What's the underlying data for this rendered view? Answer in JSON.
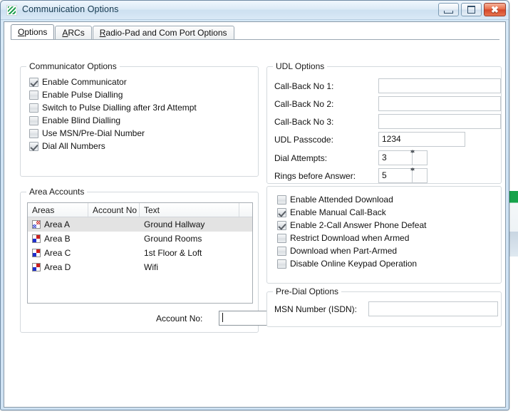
{
  "window": {
    "title": "Communication Options",
    "app_icon": "striped-green-icon",
    "buttons": {
      "minimize": "minimize-icon",
      "maximize": "maximize-icon",
      "close": "✖"
    }
  },
  "tabs": [
    {
      "label": "Options",
      "mnemonic": "O",
      "active": true
    },
    {
      "label": "ARCs",
      "mnemonic": "A",
      "active": false
    },
    {
      "label": "Radio-Pad and Com Port Options",
      "mnemonic": "R",
      "active": false
    }
  ],
  "communicator_options": {
    "legend": "Communicator Options",
    "items": [
      {
        "label": "Enable Communicator",
        "checked": true
      },
      {
        "label": "Enable Pulse Dialling",
        "checked": false
      },
      {
        "label": "Switch to Pulse Dialling after 3rd Attempt",
        "checked": false
      },
      {
        "label": "Enable Blind Dialling",
        "checked": false
      },
      {
        "label": "Use MSN/Pre-Dial Number",
        "checked": false
      },
      {
        "label": "Dial All Numbers",
        "checked": true
      }
    ]
  },
  "area_accounts": {
    "legend": "Area Accounts",
    "columns": [
      "Areas",
      "Account No",
      "Text",
      ""
    ],
    "rows": [
      {
        "area": "Area A",
        "account_no": "",
        "text": "Ground Hallway",
        "selected": true
      },
      {
        "area": "Area B",
        "account_no": "",
        "text": "Ground Rooms",
        "selected": false
      },
      {
        "area": "Area C",
        "account_no": "",
        "text": "1st Floor & Loft",
        "selected": false
      },
      {
        "area": "Area D",
        "account_no": "",
        "text": "Wifi",
        "selected": false
      }
    ],
    "account_no_label": "Account No:",
    "account_no_value": ""
  },
  "udl_options": {
    "legend": "UDL Options",
    "fields": [
      {
        "label": "Call-Back No 1:",
        "value": ""
      },
      {
        "label": "Call-Back No 2:",
        "value": ""
      },
      {
        "label": "Call-Back No 3:",
        "value": ""
      },
      {
        "label": "UDL Passcode:",
        "value": "1234"
      }
    ],
    "spinners": [
      {
        "label": "Dial Attempts:",
        "value": "3"
      },
      {
        "label": "Rings before Answer:",
        "value": "5"
      }
    ]
  },
  "download_options": {
    "items": [
      {
        "label": "Enable Attended Download",
        "checked": false
      },
      {
        "label": "Enable Manual Call-Back",
        "checked": true
      },
      {
        "label": "Enable 2-Call Answer Phone Defeat",
        "checked": true
      },
      {
        "label": "Restrict Download when Armed",
        "checked": false
      },
      {
        "label": "Download when Part-Armed",
        "checked": false
      },
      {
        "label": "Disable Online Keypad Operation",
        "checked": false
      }
    ]
  },
  "predial_options": {
    "legend": "Pre-Dial Options",
    "msn_label": "MSN Number (ISDN):",
    "msn_value": ""
  },
  "colors": {
    "title_bar": "#dceaf6",
    "window_frame": "#cfe2f3",
    "close_button": "#d4472a",
    "selection": "#e3e3e3",
    "area_icon_red": "#cc1f1f",
    "area_icon_blue": "#1f2fcc"
  }
}
